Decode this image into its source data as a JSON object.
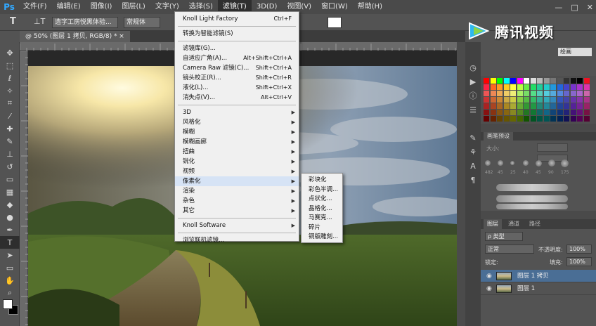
{
  "app": {
    "logo": "Ps"
  },
  "menubar": {
    "items": [
      "文件(F)",
      "编辑(E)",
      "图像(I)",
      "图层(L)",
      "文字(Y)",
      "选择(S)",
      "滤镜(T)",
      "3D(D)",
      "视图(V)",
      "窗口(W)",
      "帮助(H)"
    ],
    "active_index": 6,
    "window_controls": [
      "—",
      "□",
      "✕"
    ]
  },
  "options": {
    "tool_icon": "T",
    "orient_icon": "⊥T",
    "font_family": "造字工房悦黑体验...",
    "font_style": "常规体",
    "font_size": "10",
    "aa_mode": "aa"
  },
  "document": {
    "tab_label": "@ 50% (图层 1 拷贝, RGB/8) *  ×"
  },
  "filter_menu": {
    "items": [
      {
        "label": "Knoll Light Factory",
        "shortcut": "Ctrl+F"
      },
      {
        "sep": true
      },
      {
        "label": "转换为智能滤镜(S)"
      },
      {
        "sep": true
      },
      {
        "label": "滤镜库(G)..."
      },
      {
        "label": "自适应广角(A)...",
        "shortcut": "Alt+Shift+Ctrl+A"
      },
      {
        "label": "Camera Raw 滤镜(C)...",
        "shortcut": "Shift+Ctrl+A"
      },
      {
        "label": "镜头校正(R)...",
        "shortcut": "Shift+Ctrl+R"
      },
      {
        "label": "液化(L)...",
        "shortcut": "Shift+Ctrl+X"
      },
      {
        "label": "消失点(V)...",
        "shortcut": "Alt+Ctrl+V"
      },
      {
        "sep": true
      },
      {
        "label": "3D",
        "submenu": true
      },
      {
        "label": "风格化",
        "submenu": true
      },
      {
        "label": "模糊",
        "submenu": true
      },
      {
        "label": "模糊画廊",
        "submenu": true
      },
      {
        "label": "扭曲",
        "submenu": true
      },
      {
        "label": "锐化",
        "submenu": true
      },
      {
        "label": "视频",
        "submenu": true
      },
      {
        "label": "像素化",
        "submenu": true,
        "highlight": true
      },
      {
        "label": "渲染",
        "submenu": true
      },
      {
        "label": "杂色",
        "submenu": true
      },
      {
        "label": "其它",
        "submenu": true
      },
      {
        "sep": true
      },
      {
        "label": "Knoll Software",
        "submenu": true
      },
      {
        "sep": true
      },
      {
        "label": "浏览联机滤镜..."
      }
    ]
  },
  "pixelate_submenu": [
    "彩块化",
    "彩色半调...",
    "点状化...",
    "晶格化...",
    "马赛克...",
    "碎片",
    "铜版雕刻..."
  ],
  "watermark": {
    "text": "腾讯视频"
  },
  "right_panel": {
    "top_select": "绘画",
    "brush_tab": "画笔预设",
    "brush_size_label": "大小:",
    "brush_numbers": [
      "482",
      "45",
      "25",
      "40",
      "45",
      "90",
      "175"
    ],
    "layers_tabs": [
      "图层",
      "通道",
      "路径"
    ],
    "filter_kind": "ρ 类型",
    "blend_mode": "正常",
    "opacity_label": "不透明度:",
    "opacity_value": "100%",
    "lock_label": "锁定:",
    "fill_label": "填充:",
    "fill_value": "100%",
    "layers": [
      {
        "name": "图层 1 拷贝",
        "selected": true
      },
      {
        "name": "图层 1",
        "selected": false
      }
    ]
  },
  "toolbar": {
    "tools": [
      "move-icon",
      "marquee-icon",
      "lasso-icon",
      "quick-select-icon",
      "crop-icon",
      "eyedropper-icon",
      "healing-icon",
      "brush-icon",
      "clone-stamp-icon",
      "history-brush-icon",
      "eraser-icon",
      "gradient-icon",
      "blur-icon",
      "dodge-icon",
      "pen-icon",
      "type-icon",
      "path-select-icon",
      "shape-icon",
      "hand-icon",
      "zoom-icon"
    ]
  }
}
